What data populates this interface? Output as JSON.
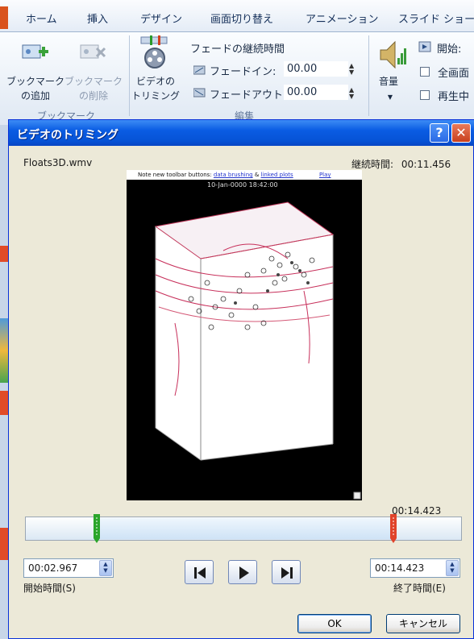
{
  "ribbon": {
    "tabs": [
      "ホーム",
      "挿入",
      "デザイン",
      "画面切り替え",
      "アニメーション",
      "スライド ショー"
    ],
    "bookmark_add": "ブックマーク\nの追加",
    "bookmark_add_l1": "ブックマーク",
    "bookmark_add_l2": "の追加",
    "bookmark_remove_l1": "ブックマーク",
    "bookmark_remove_l2": "の削除",
    "bookmark_group": "ブックマーク",
    "trim_l1": "ビデオの",
    "trim_l2": "トリミング",
    "fade_heading": "フェードの継続時間",
    "fade_in_label": "フェードイン:",
    "fade_in_value": "00.00",
    "fade_out_label": "フェードアウト:",
    "fade_out_value": "00.00",
    "edit_group": "編集",
    "volume_label": "音量",
    "start_label": "開始:",
    "fullscreen_label": "全画面",
    "playing_label": "再生中"
  },
  "dialog": {
    "title": "ビデオのトリミング",
    "filename": "Floats3D.wmv",
    "duration_label": "継続時間:",
    "duration_value": "00:11.456",
    "video": {
      "toolbar_text": "Note new toolbar buttons:",
      "toolbar_link1": "data brushing",
      "toolbar_amp": "&",
      "toolbar_link2": "linked plots",
      "toolbar_play": "Play",
      "timestamp": "10-Jan-0000 18:42:00"
    },
    "end_marker_time": "00:14.423",
    "start_time_value": "00:02.967",
    "start_time_label": "開始時間(S)",
    "end_time_value": "00:14.423",
    "end_time_label": "終了時間(E)",
    "ok_label": "OK",
    "cancel_label": "キャンセル"
  },
  "colors": {
    "title_bar": "#0a5ce3",
    "start_handle": "#2aa52a",
    "end_handle": "#e0432a",
    "dialog_bg": "#ece9d8"
  }
}
